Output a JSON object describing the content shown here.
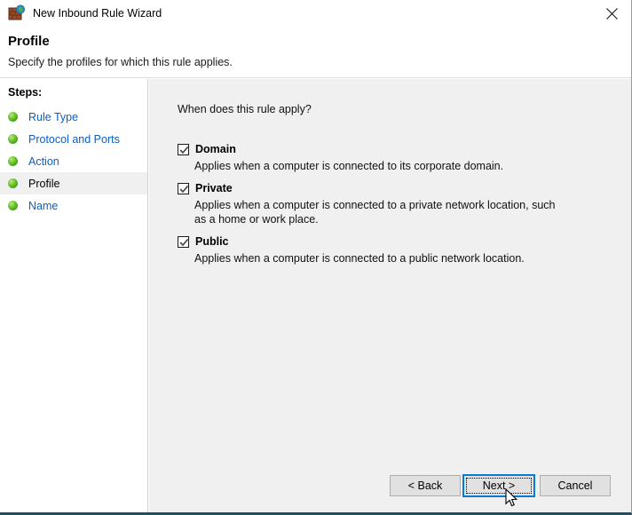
{
  "window": {
    "title": "New Inbound Rule Wizard",
    "icon": "firewall-globe-icon",
    "close_label": "×"
  },
  "header": {
    "title": "Profile",
    "subtitle": "Specify the profiles for which this rule applies."
  },
  "sidebar": {
    "heading": "Steps:",
    "items": [
      {
        "label": "Rule Type",
        "current": false
      },
      {
        "label": "Protocol and Ports",
        "current": false
      },
      {
        "label": "Action",
        "current": false
      },
      {
        "label": "Profile",
        "current": true
      },
      {
        "label": "Name",
        "current": false
      }
    ]
  },
  "main": {
    "question": "When does this rule apply?",
    "options": [
      {
        "label": "Domain",
        "checked": true,
        "description": "Applies when a computer is connected to its corporate domain."
      },
      {
        "label": "Private",
        "checked": true,
        "description": "Applies when a computer is connected to a private network location, such as a home or work place."
      },
      {
        "label": "Public",
        "checked": true,
        "description": "Applies when a computer is connected to a public network location."
      }
    ]
  },
  "buttons": {
    "back": "< Back",
    "next": "Next >",
    "cancel": "Cancel"
  },
  "colors": {
    "accent_focus": "#0a7cd0",
    "link": "#0b5fbe",
    "panel": "#f0f0f0",
    "window_bottom_border": "#1c4f6b",
    "step_bullet": "#3f9c10"
  }
}
